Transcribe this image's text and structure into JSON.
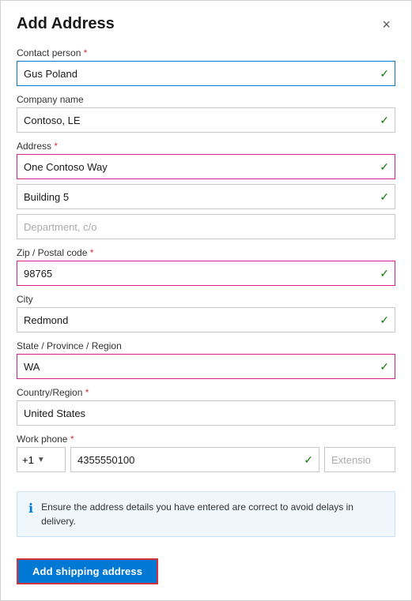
{
  "dialog": {
    "title": "Add Address",
    "close_label": "×"
  },
  "fields": {
    "contact_person": {
      "label": "Contact person",
      "required": true,
      "value": "Gus Poland",
      "style": "blue-border"
    },
    "company_name": {
      "label": "Company name",
      "required": false,
      "value": "Contoso, LE",
      "style": "normal"
    },
    "address": {
      "label": "Address",
      "required": true
    },
    "address_line1": {
      "value": "One Contoso Way",
      "style": "magenta"
    },
    "address_line2": {
      "value": "Building 5",
      "style": "normal"
    },
    "address_line3": {
      "placeholder": "Department, c/o",
      "value": "",
      "style": "normal"
    },
    "zip": {
      "label": "Zip / Postal code",
      "required": true,
      "value": "98765",
      "style": "magenta"
    },
    "city": {
      "label": "City",
      "required": false,
      "value": "Redmond",
      "style": "normal"
    },
    "state": {
      "label": "State / Province / Region",
      "required": false,
      "value": "WA",
      "style": "magenta"
    },
    "country": {
      "label": "Country/Region",
      "required": true,
      "value": "United States",
      "style": "normal"
    },
    "work_phone": {
      "label": "Work phone",
      "required": true,
      "prefix": "+1",
      "value": "4355550100",
      "extension_placeholder": "Extension",
      "style": "normal"
    }
  },
  "info_message": "Ensure the address details you have entered are correct to avoid delays in delivery.",
  "buttons": {
    "add_shipping": "Add shipping address"
  }
}
